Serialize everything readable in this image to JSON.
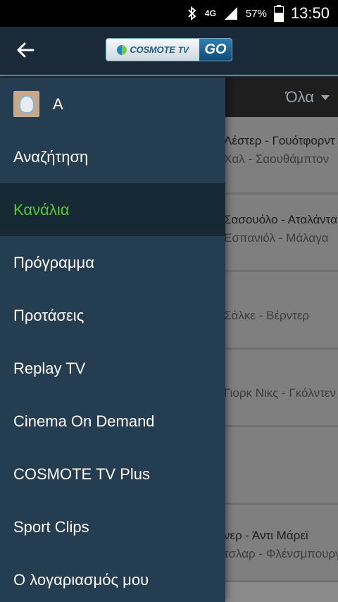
{
  "status_bar": {
    "bluetooth_icon": "bluetooth-icon",
    "network_label": "4G",
    "battery_percent": "57%",
    "time": "13:50"
  },
  "app_bar": {
    "back_icon": "arrow-left-icon",
    "logo_text": "COSMOTE",
    "logo_tv": "TV",
    "logo_go": "GO",
    "accent_color": "#2da5c0"
  },
  "filter": {
    "label": "Όλα"
  },
  "list_items": [
    {
      "line1": "Λέστερ - Γουότφορντ",
      "line2": "Χαλ - Σαουθάμπτον"
    },
    {
      "line1": "Σασουόλο - Αταλάντα",
      "line2": "Εσπανιόλ - Μάλαγα"
    },
    {
      "line1": "",
      "line2": "Σάλκε - Βέρντερ"
    },
    {
      "line1": "",
      "line2": "Γιορκ Νικς - Γκόλντεν"
    },
    {
      "line1": "",
      "line2": ""
    },
    {
      "line1": "νερ - Άντι Μάρεϊ",
      "line2": "τσλαρ - Φλένσμπουργκ"
    }
  ],
  "drawer": {
    "profile_name": "Α",
    "active_color": "#58c534",
    "items": [
      {
        "label": "Αναζήτηση"
      },
      {
        "label": "Κανάλια"
      },
      {
        "label": "Πρόγραμμα"
      },
      {
        "label": "Προτάσεις"
      },
      {
        "label": "Replay TV"
      },
      {
        "label": "Cinema On Demand"
      },
      {
        "label": "COSMOTE TV Plus"
      },
      {
        "label": "Sport Clips"
      },
      {
        "label": "Ο λογαριασμός μου"
      }
    ]
  }
}
